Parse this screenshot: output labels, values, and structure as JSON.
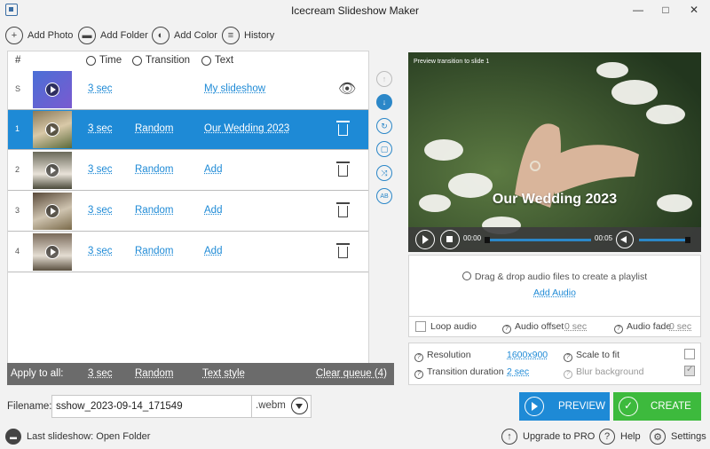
{
  "window": {
    "title": "Icecream Slideshow Maker"
  },
  "toolbar": {
    "add_photo": "Add Photo",
    "add_folder": "Add Folder",
    "add_color": "Add Color",
    "history": "History"
  },
  "table": {
    "headers": {
      "num": "#",
      "time": "Time",
      "transition": "Transition",
      "text": "Text"
    },
    "rows": [
      {
        "num": "S",
        "time": "3 sec",
        "transition": "",
        "text": "My slideshow",
        "action": "eye-icon",
        "selected": false
      },
      {
        "num": "1",
        "time": "3 sec",
        "transition": "Random",
        "text": "Our Wedding 2023",
        "action": "trash-icon",
        "selected": true
      },
      {
        "num": "2",
        "time": "3 sec",
        "transition": "Random",
        "text": "Add",
        "action": "trash-icon",
        "selected": false
      },
      {
        "num": "3",
        "time": "3 sec",
        "transition": "Random",
        "text": "Add",
        "action": "trash-icon",
        "selected": false
      },
      {
        "num": "4",
        "time": "3 sec",
        "transition": "Random",
        "text": "Add",
        "action": "trash-icon",
        "selected": false
      }
    ]
  },
  "apply_bar": {
    "label": "Apply to all:",
    "time": "3 sec",
    "transition": "Random",
    "text_style": "Text style",
    "clear_queue": "Clear queue (4)"
  },
  "filename": {
    "label": "Filename:",
    "value": "sshow_2023-09-14_171549",
    "extension": ".webm"
  },
  "preview": {
    "caption": "Preview transition to slide 1",
    "overlay_title": "Our Wedding 2023",
    "time_current": "00:00",
    "time_total": "00:05"
  },
  "audio": {
    "hint": "Drag & drop audio files to create a playlist",
    "add_audio": "Add Audio",
    "loop_label": "Loop audio",
    "offset_label": "Audio offset",
    "offset_value": "0 sec",
    "fade_label": "Audio fade",
    "fade_value": "0 sec"
  },
  "settings": {
    "resolution_label": "Resolution",
    "resolution_value": "1600x900",
    "transition_duration_label": "Transition duration",
    "transition_duration_value": "2 sec",
    "scale_label": "Scale to fit",
    "blur_label": "Blur background"
  },
  "actions": {
    "preview": "PREVIEW",
    "create": "CREATE"
  },
  "footer": {
    "last_slideshow": "Last slideshow: Open Folder",
    "upgrade": "Upgrade to PRO",
    "help": "Help",
    "settings": "Settings"
  },
  "colors": {
    "accent": "#1e8ad6",
    "create_green": "#3dba3d",
    "preview_blue": "#1e8ad6"
  }
}
